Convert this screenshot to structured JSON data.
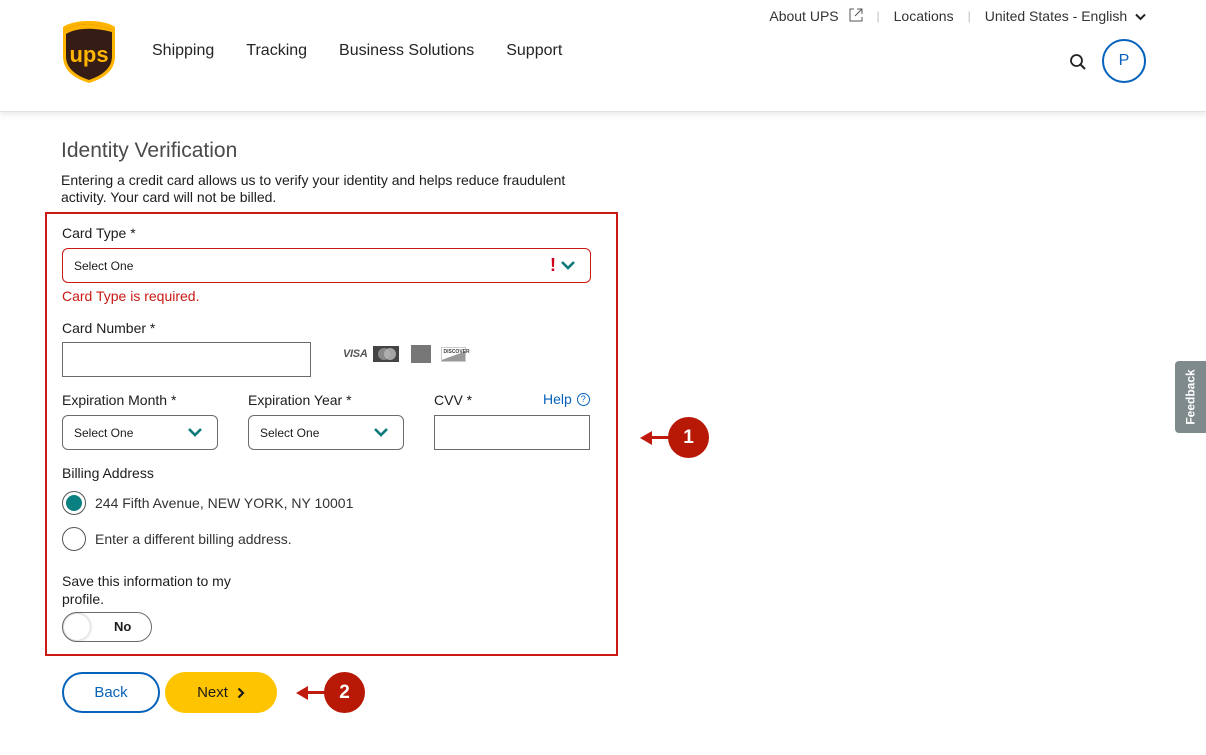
{
  "header": {
    "utility_links": [
      {
        "label": "About UPS",
        "icon": "external-link-icon"
      },
      {
        "label": "Locations"
      },
      {
        "label": "United States - English",
        "icon": "chevron-down-icon"
      }
    ],
    "nav_items": [
      "Shipping",
      "Tracking",
      "Business Solutions",
      "Support"
    ],
    "avatar_initial": "P",
    "logo_text": "ups"
  },
  "page": {
    "title": "Identity Verification",
    "intro": "Entering a credit card allows us to verify your identity and helps reduce fraudulent activity. Your card will not be billed."
  },
  "form": {
    "card_type": {
      "label": "Card Type *",
      "selected": "Select One",
      "error_icon": "!",
      "error": "Card Type is required."
    },
    "card_number": {
      "label": "Card Number *",
      "value": "",
      "accepted_cards": [
        "VISA",
        "Mastercard",
        "American Express",
        "DISCOVER"
      ]
    },
    "expiration_month": {
      "label": "Expiration Month *",
      "selected": "Select One"
    },
    "expiration_year": {
      "label": "Expiration Year *",
      "selected": "Select One"
    },
    "cvv": {
      "label": "CVV *",
      "value": "",
      "help_label": "Help",
      "help_icon": "?"
    },
    "billing_address": {
      "label": "Billing Address",
      "options": [
        {
          "label": "244 Fifth Avenue, NEW YORK, NY 10001",
          "checked": true
        },
        {
          "label": "Enter a different billing address.",
          "checked": false
        }
      ]
    },
    "save_profile": {
      "label": "Save this information to my profile.",
      "toggle_value": "No"
    }
  },
  "buttons": {
    "back": "Back",
    "next": "Next"
  },
  "annotations": [
    {
      "number": "1",
      "color": "#b81806"
    },
    {
      "number": "2",
      "color": "#b81806"
    }
  ],
  "feedback_tab": "Feedback",
  "colors": {
    "brand_brown": "#351c15",
    "brand_gold": "#ffc400",
    "link_blue": "#0662bb",
    "error_red": "#c91a14",
    "radio_teal": "#0a8080"
  }
}
